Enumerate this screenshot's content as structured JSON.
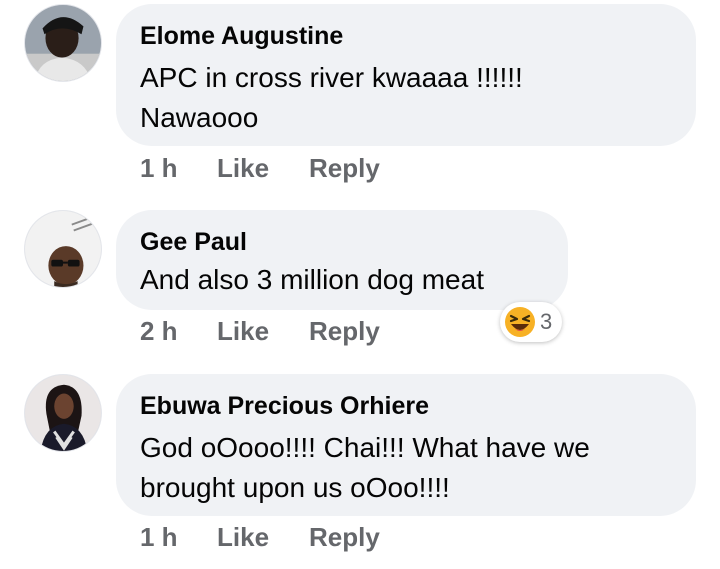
{
  "comments": [
    {
      "author": "Elome Augustine",
      "text_lines": [
        "APC in cross river kwaaaa !!!!!!",
        "Nawaooo"
      ],
      "time": "1 h",
      "like": "Like",
      "reply": "Reply"
    },
    {
      "author": "Gee Paul",
      "text_lines": [
        "And also 3 million dog meat"
      ],
      "time": "2 h",
      "like": "Like",
      "reply": "Reply",
      "reaction": {
        "icon": "laughing-emoji-icon",
        "count": "3"
      }
    },
    {
      "author": "Ebuwa Precious Orhiere",
      "text_lines": [
        "God  oOooo!!!! Chai!!! What have we",
        "brought upon us oOoo!!!!"
      ],
      "time": "1 h",
      "like": "Like",
      "reply": "Reply"
    }
  ],
  "colors": {
    "bubble": "#f0f2f5",
    "action_text": "#65676b",
    "name_text": "#050505",
    "reaction_face": "#f7b125"
  }
}
